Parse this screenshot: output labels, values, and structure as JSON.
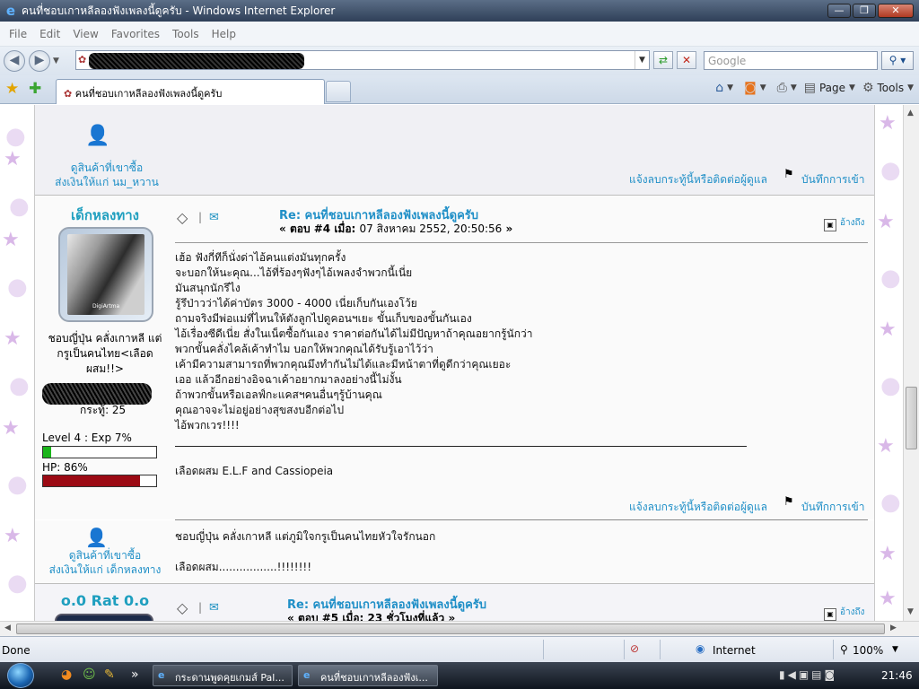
{
  "window": {
    "title": "คนที่ชอบเกาหลีลองฟังเพลงนี้ดูครับ - Windows Internet Explorer",
    "minimize": "—",
    "restore": "❐",
    "close": "✕"
  },
  "menu": [
    "File",
    "Edit",
    "View",
    "Favorites",
    "Tools",
    "Help"
  ],
  "address": {
    "search_placeholder": "Google"
  },
  "tab": {
    "label": "คนที่ชอบเกาหลีลองฟังเพลงนี้ดูครับ"
  },
  "commands": {
    "page": "Page",
    "tools": "Tools"
  },
  "post3_footer": {
    "profile_line1": "ดูสินค้าที่เขาซื้อ",
    "profile_line2": "ส่งเงินให้แก่ นม_หวาน",
    "report": "แจ้งลบกระทู้นี้หรือติดต่อผู้ดูแล",
    "log": "บันทึกการเข้า"
  },
  "post4": {
    "username": "เด็กหลงทาง",
    "avatar_caption": "DigiArtma",
    "bio": [
      "ชอบญี่ปุ่น คลั่งเกาหลี แต่",
      "กรูเป็นคนไทย<เลือด",
      "ผสม!!>"
    ],
    "karma": "กระทู้: 25",
    "level": "Level 4 : Exp 7%",
    "exp_fraction": 0.07,
    "hp": "HP: 86%",
    "hp_fraction": 0.86,
    "subject": "Re: คนที่ชอบเกาหลีลองฟังเพลงนี้ดูครับ",
    "meta_prefix": "«",
    "meta_reply": "ตอบ #4 เมื่อ:",
    "meta_date": "07 สิงหาคม 2552, 20:50:56",
    "meta_suffix": "»",
    "quote": "อ้างถึง",
    "lines": [
      "เฮ้อ  ฟังกี่ทีก็นั่งด่าไอ้คนแต่งมันทุกครั้ง",
      "จะบอกให้นะคุณ...ไอ้ที่ร้องๆฟังๆไอ้เพลงจำพวกนี้เนี่ย",
      "มันสนุกนักรึไง",
      "รู้รึป่าวว่าได้ค่าบัตร 3000 - 4000 เนี่ยเก็บกันเองโว้ย",
      "ถามจริงมีพ่อแม่ที่ไหนให้ตังลูกไปดูคอนฯเยะ ขั้นเก็บของขั้นกันเอง",
      "ไอ้เรื่องซีดีเนี่ย สั่งในเน็ตซื้อกันเอง ราคาต่อกันได้ไม่มีปัญหาถ้าคุณอยากรู้นักว่า",
      "พวกขั้นคลั่งไคล้เค้าทำไม บอกให้พวกคุณได้รับรู้เอาไว้ว่า",
      "เค้ามีความสามารถที่พวกคุณมึงทำกันไม่ได้และมีหน้าตาที่ดูดีกว่าคุณเยอะ",
      "เออ แล้วอีกอย่างอิจฉาเค้าอยากมาลงอย่างนี้ไม่งั้น",
      "ถ้าพวกขั้นหรือเอลฟ์กะแคสฯคนอื่นๆรู้บ้านคุณ",
      "คุณอาจจะไม่อยู่อย่างสุขสงบอีกต่อไป",
      "ไอ้พวกเวร!!!!"
    ],
    "sig": "เลือดผสม E.L.F  and  Cassiopeia",
    "report": "แจ้งลบกระทู้นี้หรือติดต่อผู้ดูแล",
    "log": "บันทึกการเข้า",
    "footer_profile_line1": "ดูสินค้าที่เขาซื้อ",
    "footer_profile_line2": "ส่งเงินให้แก่ เด็กหลงทาง",
    "footer_sig_line1": "ชอบญี่ปุ่น  คลั่งเกาหลี  แต่ภูมิใจกรูเป็นคนไทยหัวใจรักนอก",
    "footer_sig_line2": "เลือดผสม.................!!!!!!!!"
  },
  "post5": {
    "username": "o.0 Rat 0.o",
    "subject": "Re: คนที่ชอบเกาหลีลองฟังเพลงนี้ดูครับ",
    "meta_prefix": "«",
    "meta_reply": "ตอบ #5 เมื่อ:",
    "meta_date": "23 ชั่วโมงที่แล้ว",
    "meta_suffix": "»",
    "quote": "อ้างถึง"
  },
  "status": {
    "text": "Done",
    "zone": "Internet",
    "zoom": "100%"
  },
  "taskbar": {
    "task1": "กระดานพูดคุยเกมส์ Pal...",
    "task2": "คนที่ชอบเกาหลีลองฟังเ...",
    "clock": "21:46"
  },
  "colors": {
    "exp_bar": "#1bb51b",
    "hp_bar": "#9b0a14",
    "link": "#1f8fc7"
  }
}
